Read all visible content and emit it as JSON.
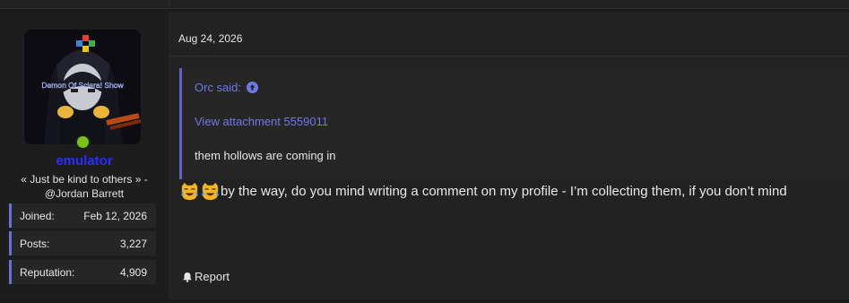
{
  "post": {
    "date": "Aug 24, 2026",
    "quote": {
      "author": "Orc said:",
      "attachment_link": "View attachment 5559011",
      "text": "them hollows are coming in"
    },
    "message": "by the way, do you mind writing a comment on my profile - I’m collecting them, if you don’t mind",
    "emoji_names": [
      "crying-laughing-cat-icon",
      "crying-laughing-cat-icon"
    ],
    "report_label": "Report"
  },
  "user": {
    "avatar_caption": "Demon Of Sciera! Show",
    "username": "emulator",
    "title": "« Just be kind to others » -@Jordan Barrett",
    "online_status_color": "#7ac11a",
    "username_color": "#2a2dff",
    "stats": [
      {
        "label": "Joined:",
        "value": "Feb 12, 2026"
      },
      {
        "label": "Posts:",
        "value": "3,227"
      },
      {
        "label": "Reputation:",
        "value": "4,909"
      }
    ]
  },
  "colors": {
    "accent": "#6e78e6",
    "background": "#1b1b1b",
    "panel": "#222222"
  }
}
